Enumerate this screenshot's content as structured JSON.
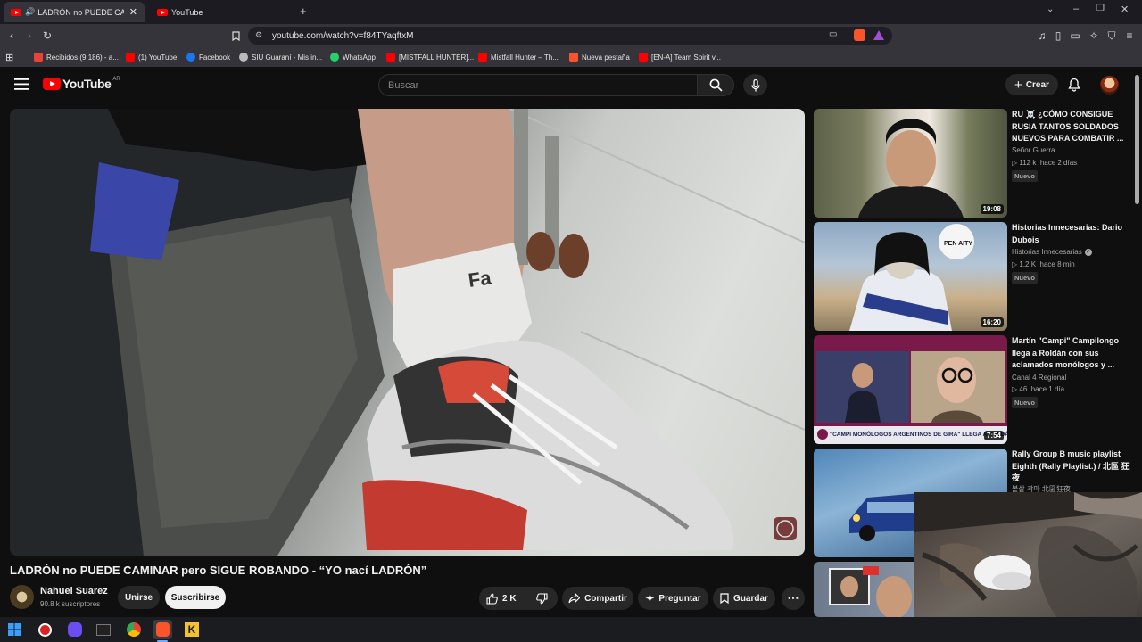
{
  "browser": {
    "tabs": [
      {
        "label": "LADRÓN no PUEDE CAMINAR pero SIGUE ROBANDO - “YO nací LADRÓN”",
        "short": "LADRÓN no PUEDE CAMINA",
        "active": true
      },
      {
        "label": "YouTube",
        "active": false
      }
    ],
    "new_tab": "+",
    "url": "youtube.com/watch?v=f84TYaqftxM",
    "bookmarks": [
      "Recibidos (9,186) - a...",
      "(1) YouTube",
      "Facebook",
      "SIU Guaraní - Mis in...",
      "WhatsApp",
      "[MISTFALL HUNTER]...",
      "Mistfall Hunter – Th...",
      "Nueva pestaña",
      "[EN-A] Team Spirit v..."
    ]
  },
  "header": {
    "logo": "YouTube",
    "region": "AR",
    "search_placeholder": "Buscar",
    "create_label": "Crear"
  },
  "video": {
    "title": "LADRÓN no PUEDE CAMINAR pero SIGUE ROBANDO - “YO nací LADRÓN”",
    "channel": "Nahuel Suarez",
    "subscribers": "90.8 k suscriptores",
    "join_label": "Unirse",
    "subscribe_label": "Suscribirse",
    "likes": "2 K",
    "share_label": "Compartir",
    "ask_label": "Preguntar",
    "save_label": "Guardar"
  },
  "sidebar": [
    {
      "title": "RU ☠️ ¿CÓMO CONSIGUE RUSIA TANTOS SOLDADOS NUEVOS PARA COMBATIR ...",
      "channel": "Señor Guerra",
      "views": "112 k",
      "age": "hace 2 días",
      "badge": "Nuevo",
      "duration": "19:08",
      "verified": false
    },
    {
      "title": "Historias Innecesarias: Dario Dubois",
      "channel": "Historias Innecesarias",
      "views": "1.2 K",
      "age": "hace 8 min",
      "badge": "Nuevo",
      "duration": "16:20",
      "verified": true
    },
    {
      "title": "Martín \"Campi\" Campilongo llega a Roldán con sus aclamados monólogos y ...",
      "channel": "Canal 4 Regional",
      "views": "46",
      "age": "hace 1 día",
      "badge": "Nuevo",
      "duration": "7:54",
      "verified": false,
      "caption": "\"CAMPI MONÓLOGOS ARGENTINOS DE GIRA\" LLEGA A ROLDÁN"
    },
    {
      "title": "Rally Group B music playlist Eighth (Rally Playlist.) / 北區 狂夜",
      "sub": "볼살 곽마 北區狂夜",
      "duration": ""
    }
  ],
  "thumb2_text": "PEN AITY",
  "colors": {
    "bg": "#0f0f0f",
    "accent": "#ff0000",
    "chip": "#272727"
  }
}
